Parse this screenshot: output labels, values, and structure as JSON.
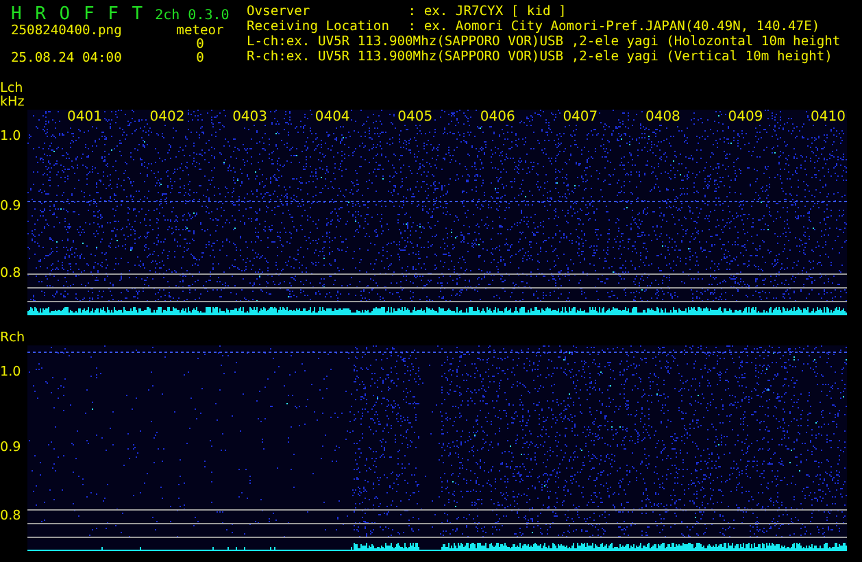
{
  "header": {
    "title": "H R O F F T",
    "version": "2ch 0.3.0",
    "file_name": "2508240400.png",
    "date_time": "25.08.24 04:00",
    "count_label": "meteor",
    "counts": [
      "0",
      "0"
    ],
    "info": [
      {
        "label": "Ovserver",
        "value": ": ex. JR7CYX [ kid ]"
      },
      {
        "label": "Receiving Location",
        "value": ": ex. Aomori City Aomori-Pref.JAPAN(40.49N, 140.47E)"
      },
      {
        "value": "L-ch:ex. UV5R 113.900Mhz(SAPPORO VOR)USB ,2-ele yagi (Holozontal 10m height"
      },
      {
        "value": "R-ch:ex. UV5R 113.900Mhz(SAPPORO VOR)USB ,2-ele yagi (Vertical 10m height)"
      }
    ]
  },
  "channels": [
    {
      "label": "Lch",
      "unit": "kHz",
      "ticks": [
        "1.0",
        "0.9",
        "0.8"
      ],
      "time_labels": [
        "0401",
        "0402",
        "0403",
        "0404",
        "0405",
        "0406",
        "0407",
        "0408",
        "0409",
        "0410"
      ]
    },
    {
      "label": "Rch",
      "ticks": [
        "1.0",
        "0.9",
        "0.8"
      ]
    }
  ]
}
